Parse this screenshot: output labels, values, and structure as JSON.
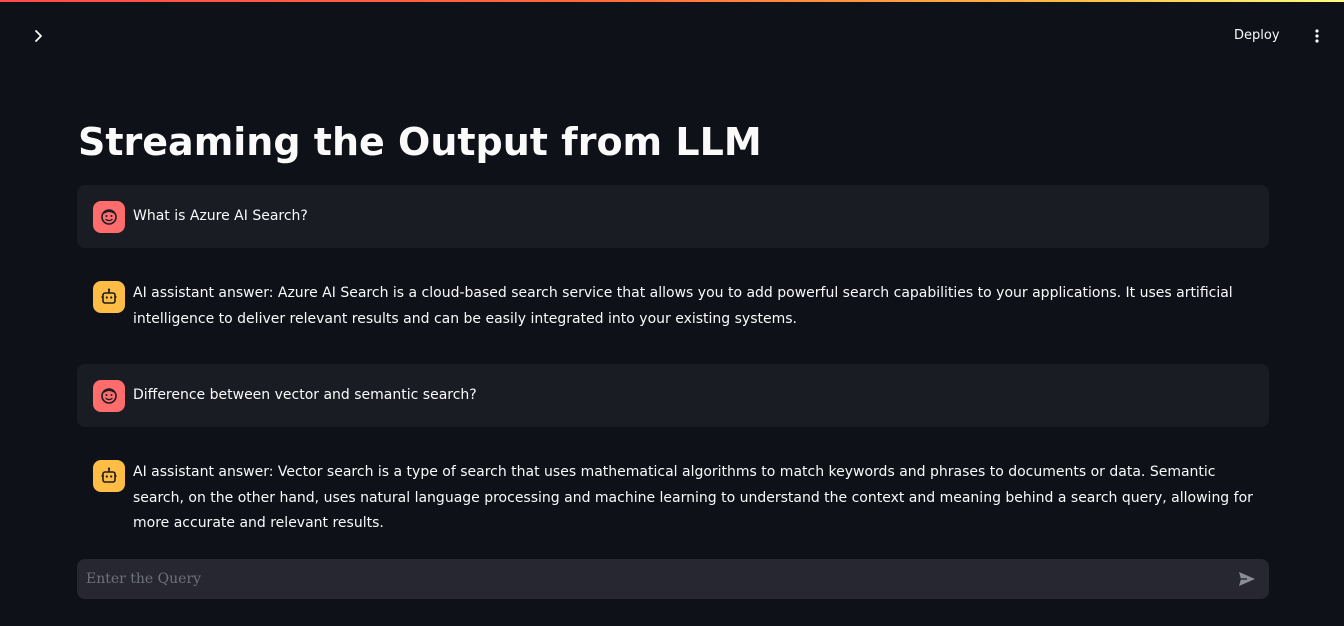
{
  "header": {
    "deploy_label": "Deploy",
    "sidebar_toggle_icon": "chevron-right-icon",
    "menu_icon": "vertical-dots-icon"
  },
  "page": {
    "title": "Streaming the Output from LLM"
  },
  "messages": [
    {
      "role": "user",
      "avatar_icon": "user-face-icon",
      "text": "What is Azure AI Search?"
    },
    {
      "role": "assistant",
      "avatar_icon": "robot-icon",
      "text": "AI assistant answer: Azure AI Search is a cloud-based search service that allows you to add powerful search capabilities to your applications. It uses artificial intelligence to deliver relevant results and can be easily integrated into your existing systems."
    },
    {
      "role": "user",
      "avatar_icon": "user-face-icon",
      "text": "Difference between vector and semantic search?"
    },
    {
      "role": "assistant",
      "avatar_icon": "robot-icon",
      "text": "AI assistant answer: Vector search is a type of search that uses mathematical algorithms to match keywords and phrases to documents or data. Semantic search, on the other hand, uses natural language processing and machine learning to understand the context and meaning behind a search query, allowing for more accurate and relevant results."
    }
  ],
  "chat_input": {
    "placeholder": "Enter the Query",
    "value": "",
    "send_icon": "send-icon"
  },
  "colors": {
    "background": "#0e1117",
    "user_message_bg": "#1a1c24",
    "user_avatar": "#ff6c6c",
    "assistant_avatar": "#ffbd45",
    "input_bg": "#262730"
  }
}
